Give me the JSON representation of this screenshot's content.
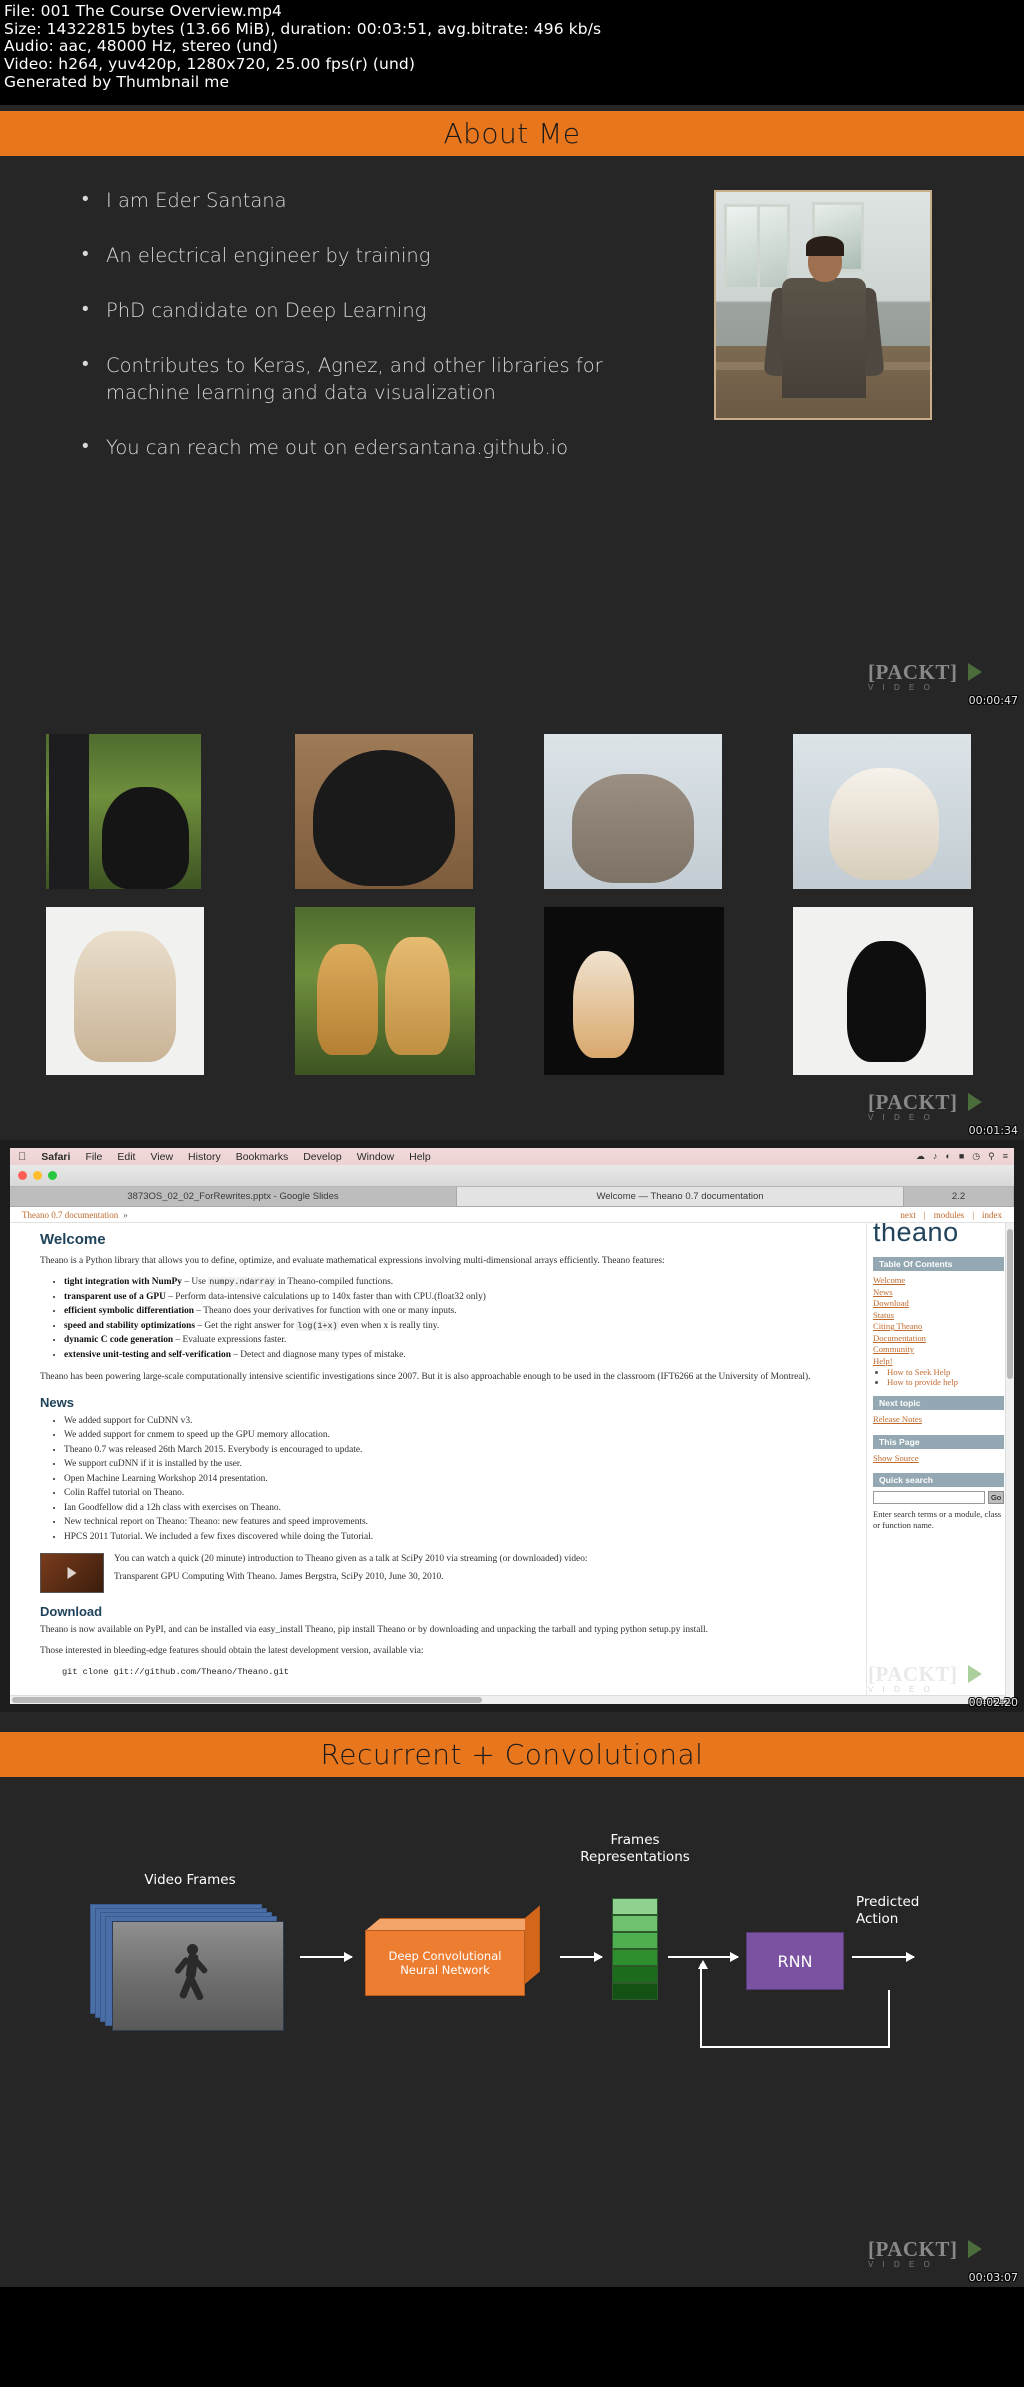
{
  "header": {
    "file": "File: 001 The Course Overview.mp4",
    "size": "Size: 14322815 bytes (13.66 MiB), duration: 00:03:51, avg.bitrate: 496 kb/s",
    "audio": "Audio: aac, 48000 Hz, stereo (und)",
    "video": "Video: h264, yuv420p, 1280x720, 25.00 fps(r) (und)",
    "generated": "Generated by Thumbnail me"
  },
  "watermark": {
    "text": "PACKT",
    "sub": "V I D E O"
  },
  "frames": [
    {
      "timestamp": "00:00:47"
    },
    {
      "timestamp": "00:01:34"
    },
    {
      "timestamp": "00:02:20"
    },
    {
      "timestamp": "00:03:07"
    }
  ],
  "slide1": {
    "title": "About Me",
    "bullets": [
      "I am Eder Santana",
      "An electrical engineer by training",
      "PhD candidate on Deep Learning",
      "Contributes to Keras, Agnez, and other libraries for machine learning and data visualization",
      "You can reach me out on edersantana.github.io"
    ],
    "photo_alt": "portrait-of-presenter"
  },
  "slide2": {
    "images": [
      {
        "alt": "black-puppy-on-grass"
      },
      {
        "alt": "black-labrador-dog"
      },
      {
        "alt": "tabby-cat-lying-down"
      },
      {
        "alt": "white-kitten"
      },
      {
        "alt": "english-bulldog"
      },
      {
        "alt": "two-golden-retrievers"
      },
      {
        "alt": "two-ginger-kittens"
      },
      {
        "alt": "black-kitten-standing"
      }
    ]
  },
  "slide3": {
    "menubar": {
      "apple": "apple-logo",
      "items": [
        "Safari",
        "File",
        "Edit",
        "View",
        "History",
        "Bookmarks",
        "Develop",
        "Window",
        "Help"
      ],
      "status_icons": [
        "bluetooth-icon",
        "volume-icon",
        "wifi-icon",
        "battery-icon",
        "clock-icon",
        "search-icon",
        "menu-icon"
      ]
    },
    "tabs": [
      {
        "label": "3873OS_02_02_ForRewrites.pptx - Google Slides",
        "active": false
      },
      {
        "label": "Welcome — Theano 0.7 documentation",
        "active": true
      },
      {
        "label": "2.2",
        "active": false
      }
    ],
    "breadcrumb": {
      "path": "Theano 0.7 documentation",
      "separator": "»",
      "links": [
        "next",
        "modules",
        "index"
      ]
    },
    "main": {
      "welcome_heading": "Welcome",
      "intro": "Theano is a Python library that allows you to define, optimize, and evaluate mathematical expressions involving multi-dimensional arrays efficiently. Theano features:",
      "features": [
        {
          "bold": "tight integration with NumPy",
          "rest": " – Use ",
          "code": "numpy.ndarray",
          "tail": " in Theano-compiled functions."
        },
        {
          "bold": "transparent use of a GPU",
          "rest": " – Perform data-intensive calculations up to 140x faster than with CPU.(float32 only)",
          "code": "",
          "tail": ""
        },
        {
          "bold": "efficient symbolic differentiation",
          "rest": " – Theano does your derivatives for function with one or many inputs.",
          "code": "",
          "tail": ""
        },
        {
          "bold": "speed and stability optimizations",
          "rest": " – Get the right answer for ",
          "code": "log(1+x)",
          "tail": " even when x is really tiny."
        },
        {
          "bold": "dynamic C code generation",
          "rest": " – Evaluate expressions faster.",
          "code": "",
          "tail": ""
        },
        {
          "bold": "extensive unit-testing and self-verification",
          "rest": " – Detect and diagnose many types of mistake.",
          "code": "",
          "tail": ""
        }
      ],
      "powering": "Theano has been powering large-scale computationally intensive scientific investigations since 2007. But it is also approachable enough to be used in the classroom (IFT6266 at the University of Montreal).",
      "news_heading": "News",
      "news": [
        "We added support for CuDNN v3.",
        "We added support for cnmem to speed up the GPU memory allocation.",
        "Theano 0.7 was released 26th March 2015. Everybody is encouraged to update.",
        "We support cuDNN if it is installed by the user.",
        "Open Machine Learning Workshop 2014 presentation.",
        "Colin Raffel tutorial on Theano.",
        "Ian Goodfellow did a 12h class with exercises on Theano.",
        "New technical report on Theano: Theano: new features and speed improvements.",
        "HPCS 2011 Tutorial. We included a few fixes discovered while doing the Tutorial."
      ],
      "video_note": "You can watch a quick (20 minute) introduction to Theano given as a talk at SciPy 2010 via streaming (or downloaded) video:",
      "video_caption": "Transparent GPU Computing With Theano. James Bergstra, SciPy 2010, June 30, 2010.",
      "download_heading": "Download",
      "download_text_1": "Theano is now available on PyPI, and can be installed via easy_install Theano, pip install Theano or by downloading and unpacking the tarball and typing python setup.py install.",
      "download_text_2": "Those interested in bleeding-edge features should obtain the latest development version, available via:",
      "git_command": "git clone git://github.com/Theano/Theano.git"
    },
    "sidebar": {
      "logo": "theano",
      "toc_heading": "Table Of Contents",
      "toc": [
        "Welcome",
        "News",
        "Download",
        "Status",
        "Citing Theano",
        "Documentation",
        "Community",
        "Help!"
      ],
      "toc_sub": [
        "How to Seek Help",
        "How to provide help"
      ],
      "next_topic_heading": "Next topic",
      "next_topic": "Release Notes",
      "this_page_heading": "This Page",
      "this_page": "Show Source",
      "quick_search_heading": "Quick search",
      "search_value": "",
      "search_placeholder": "",
      "go_label": "Go",
      "search_note": "Enter search terms or a module, class or function name."
    }
  },
  "slide4": {
    "title": "Recurrent + Convolutional",
    "labels": {
      "video_frames": "Video Frames",
      "frames_representations": "Frames\nRepresentations",
      "cnn": "Deep Convolutional\nNeural Network",
      "rnn": "RNN",
      "predicted_action": "Predicted\nAction"
    },
    "colors": {
      "accent_orange": "#ed7d31",
      "rnn_purple": "#7a52a1",
      "frame_greens": [
        "#7fc67f",
        "#62b562",
        "#49a249",
        "#2f8f2f",
        "#1d6b1d"
      ]
    }
  }
}
